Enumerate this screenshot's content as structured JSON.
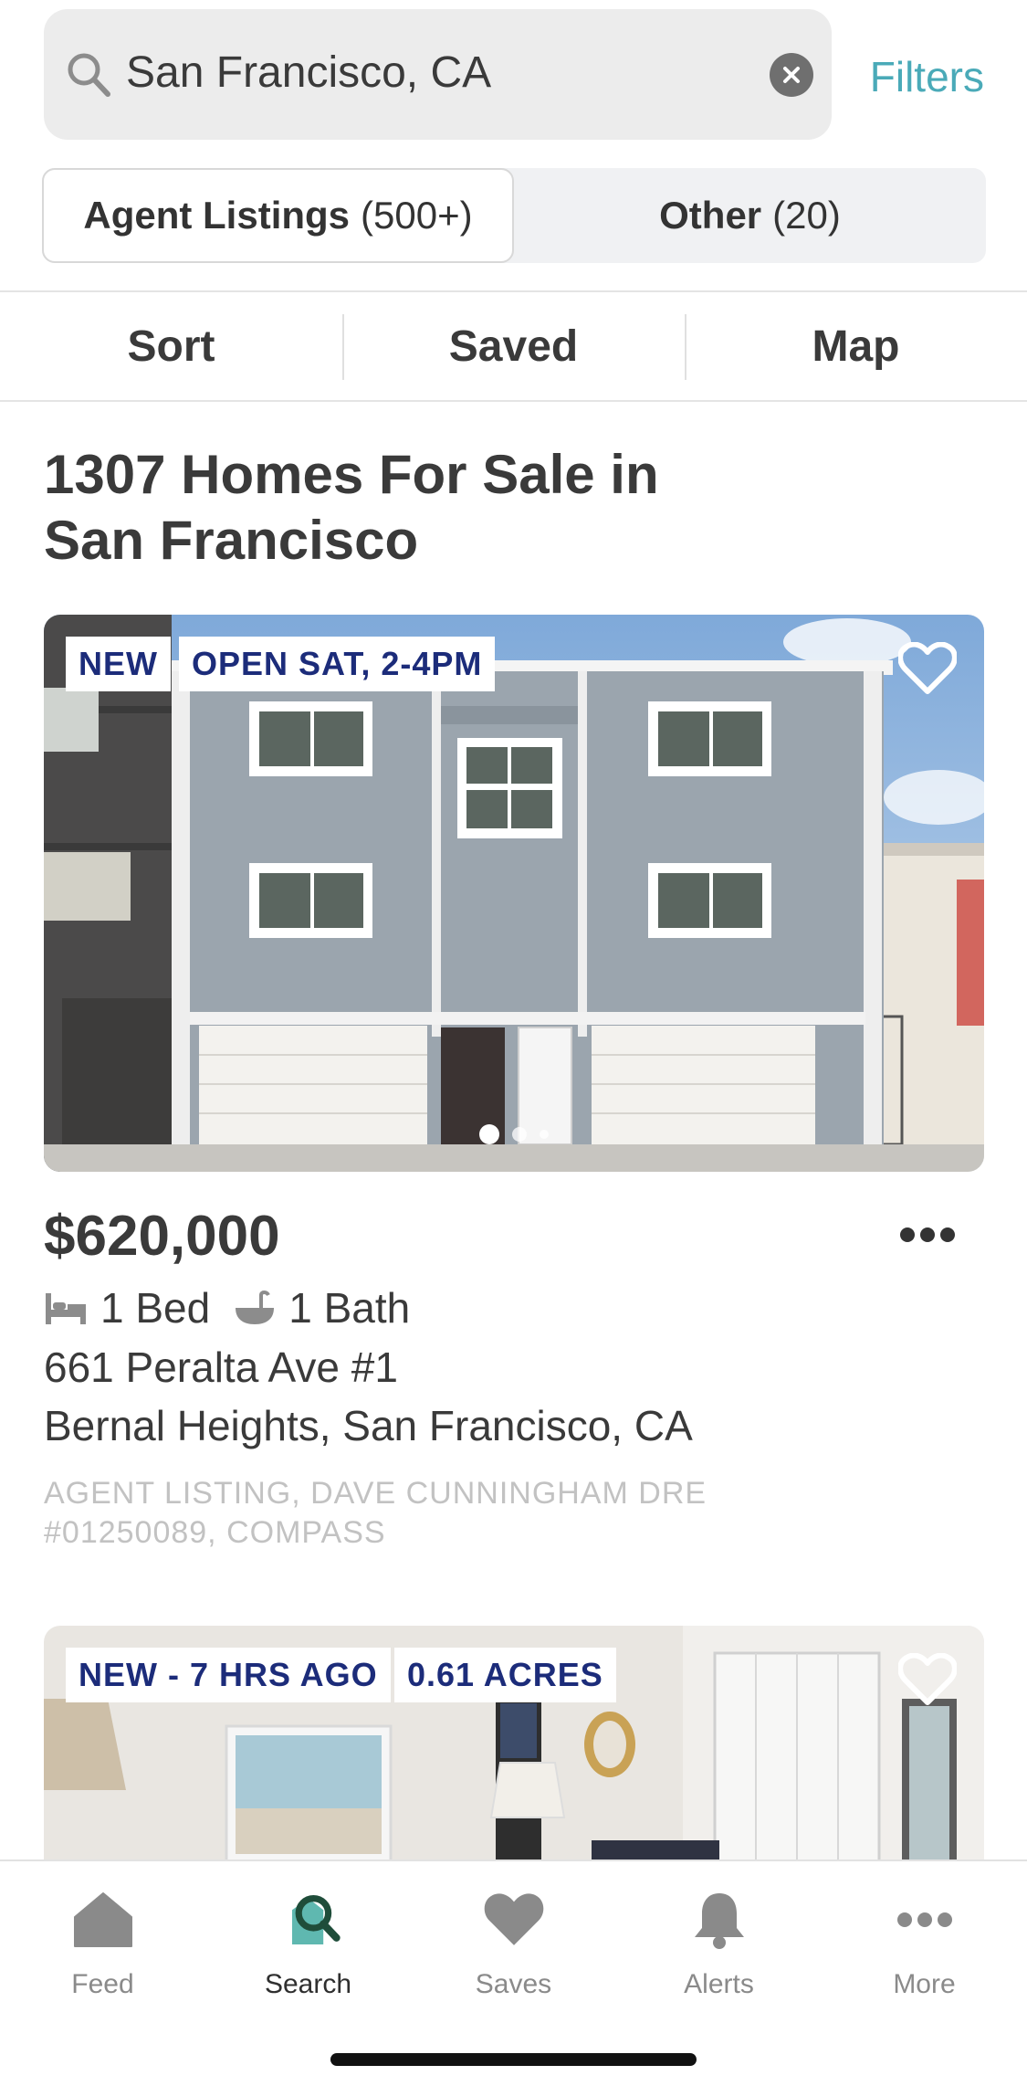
{
  "search": {
    "value": "San Francisco, CA",
    "filters_label": "Filters"
  },
  "segments": {
    "agent": {
      "label": "Agent Listings",
      "count": "(500+)"
    },
    "other": {
      "label": "Other",
      "count": "(20)"
    },
    "selected": "agent"
  },
  "toolbar": {
    "sort_label": "Sort",
    "saved_label": "Saved",
    "map_label": "Map"
  },
  "results": {
    "heading_line1": "1307 Homes For Sale in",
    "heading_line2": "San Francisco"
  },
  "listings": [
    {
      "badges": [
        "NEW",
        "OPEN SAT, 2-4PM"
      ],
      "photo_index": 1,
      "photo_count": 3,
      "price": "$620,000",
      "beds": "1 Bed",
      "baths": "1 Bath",
      "address_line1": "661 Peralta Ave  #1",
      "address_line2": "Bernal Heights, San Francisco, CA",
      "disclaimer_line1": "AGENT LISTING, DAVE CUNNINGHAM DRE",
      "disclaimer_line2": "#01250089, COMPASS"
    },
    {
      "badges": [
        "NEW - 7 HRS AGO",
        "0.61 ACRES"
      ]
    }
  ],
  "tabbar": {
    "items": [
      {
        "label": "Feed",
        "icon": "home-icon"
      },
      {
        "label": "Search",
        "icon": "search-home-icon",
        "active": true
      },
      {
        "label": "Saves",
        "icon": "heart-icon"
      },
      {
        "label": "Alerts",
        "icon": "bell-icon"
      },
      {
        "label": "More",
        "icon": "more-dots-icon"
      }
    ]
  },
  "colors": {
    "accent": "#4aaab8",
    "badge_text": "#1c2c7a",
    "text": "#3a3a3a",
    "inactive_tab": "#8a8a8a",
    "search_tab_dark": "#1f4d3a"
  }
}
